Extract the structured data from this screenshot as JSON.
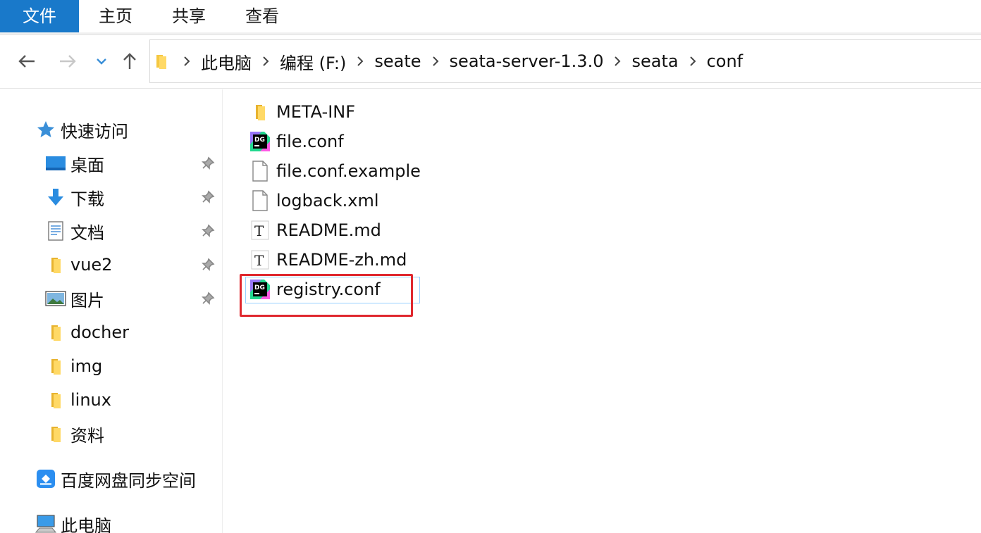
{
  "ribbon": {
    "tabs": [
      "文件",
      "主页",
      "共享",
      "查看"
    ]
  },
  "address": {
    "crumbs": [
      "此电脑",
      "编程 (F:)",
      "seate",
      "seata-server-1.3.0",
      "seata",
      "conf"
    ]
  },
  "nav": {
    "quick_access": "快速访问",
    "items": [
      "桌面",
      "下载",
      "文档",
      "vue2",
      "图片",
      "docher",
      "img",
      "linux",
      "资料"
    ],
    "baidu": "百度网盘同步空间",
    "this_pc": "此电脑"
  },
  "files": [
    "META-INF",
    "file.conf",
    "file.conf.example",
    "logback.xml",
    "README.md",
    "README-zh.md",
    "registry.conf"
  ],
  "icons": {
    "folder": "folder-icon",
    "datagrip": "datagrip-icon",
    "blank": "blank-file-icon",
    "text": "text-file-icon"
  },
  "colors": {
    "accent": "#1979ca",
    "highlight": "#e0282e",
    "selection": "#99d1ff",
    "folder": "#f5c842"
  }
}
